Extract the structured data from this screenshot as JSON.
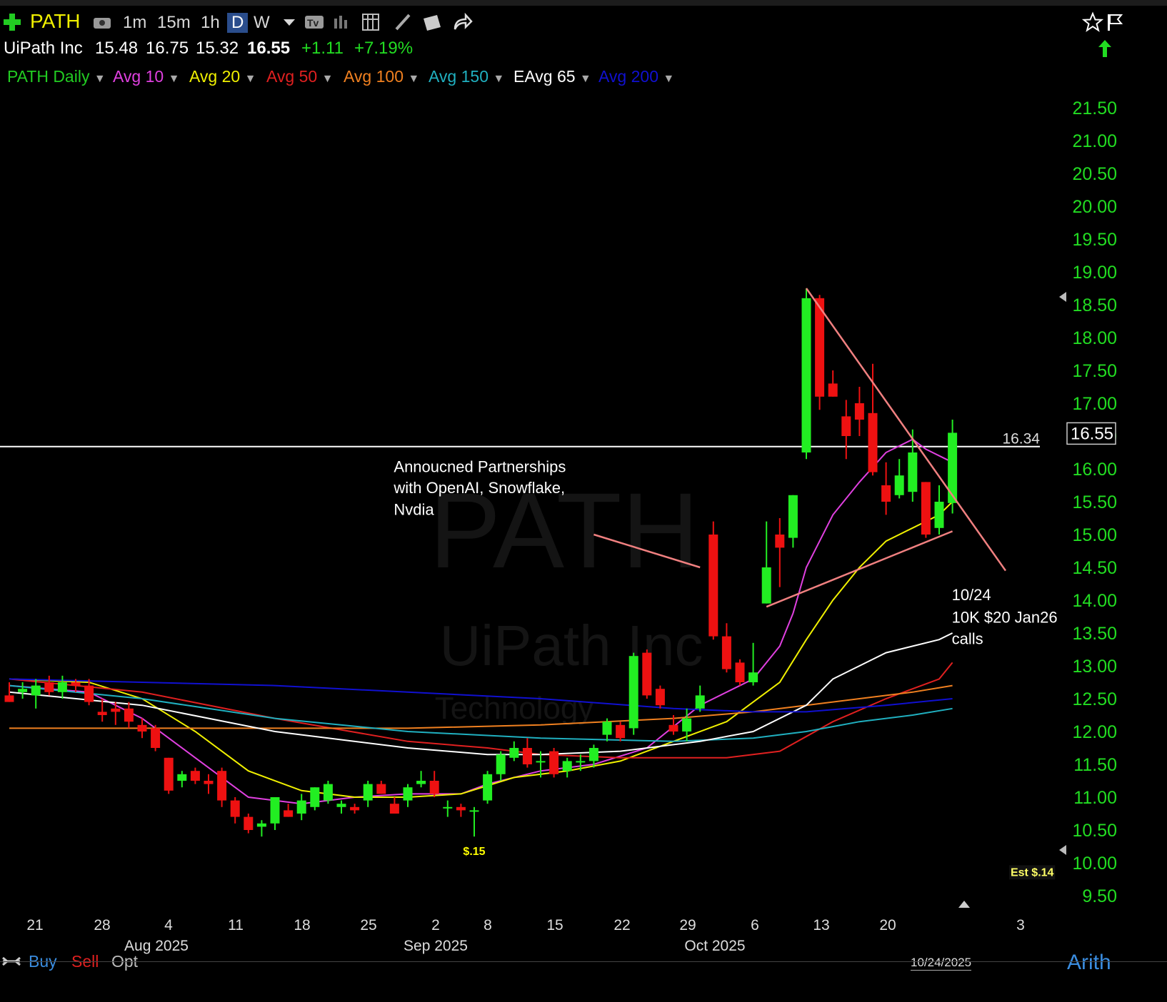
{
  "toolbar": {
    "symbol": "PATH",
    "intervals": [
      "1m",
      "15m",
      "1h",
      "D",
      "W"
    ],
    "active_interval": "D",
    "icons": [
      "add-icon",
      "camera-icon",
      "template-icon",
      "bars-icon",
      "grid-icon",
      "pencil-icon",
      "folder-icon",
      "share-icon",
      "star-icon"
    ]
  },
  "quote": {
    "name": "UiPath Inc",
    "open": "15.48",
    "high": "16.75",
    "low": "15.32",
    "last": "16.55",
    "change": "+1.11",
    "change_pct": "+7.19%"
  },
  "legend": [
    {
      "label": "PATH Daily",
      "color": "#22cc22"
    },
    {
      "label": "Avg 10",
      "color": "#e040e0"
    },
    {
      "label": "Avg 20",
      "color": "#f0f000"
    },
    {
      "label": "Avg 50",
      "color": "#e02020"
    },
    {
      "label": "Avg 100",
      "color": "#f08020"
    },
    {
      "label": "Avg 150",
      "color": "#20b0c0"
    },
    {
      "label": "EAvg 65",
      "color": "#ffffff"
    },
    {
      "label": "Avg 200",
      "color": "#1010d0"
    }
  ],
  "watermark": {
    "symbol": "PATH",
    "name": "UiPath Inc",
    "sector": "Technology"
  },
  "chart_data": {
    "type": "candlestick",
    "ylim": [
      9.3,
      21.8
    ],
    "y_ticks": [
      "21.50",
      "21.00",
      "20.50",
      "20.00",
      "19.50",
      "19.00",
      "18.50",
      "18.00",
      "17.50",
      "17.00",
      "16.50",
      "16.00",
      "15.50",
      "15.00",
      "14.50",
      "14.00",
      "13.50",
      "13.00",
      "12.50",
      "12.00",
      "11.50",
      "11.00",
      "10.50",
      "10.00",
      "9.50"
    ],
    "x_ticks": [
      "21",
      "28",
      "4",
      "11",
      "18",
      "25",
      "2",
      "8",
      "15",
      "22",
      "29",
      "6",
      "13",
      "20",
      "3"
    ],
    "month_labels": [
      "Aug 2025",
      "Sep 2025",
      "Oct 2025"
    ],
    "last_price_label": "16.55",
    "horizontal_line": {
      "value": 16.34,
      "label": "16.34"
    },
    "candles": [
      {
        "o": 12.55,
        "h": 12.75,
        "l": 12.45,
        "c": 12.45
      },
      {
        "o": 12.6,
        "h": 12.75,
        "l": 12.5,
        "c": 12.65
      },
      {
        "o": 12.55,
        "h": 12.8,
        "l": 12.35,
        "c": 12.7
      },
      {
        "o": 12.75,
        "h": 12.85,
        "l": 12.55,
        "c": 12.6
      },
      {
        "o": 12.6,
        "h": 12.85,
        "l": 12.5,
        "c": 12.75
      },
      {
        "o": 12.75,
        "h": 12.8,
        "l": 12.6,
        "c": 12.7
      },
      {
        "o": 12.7,
        "h": 12.8,
        "l": 12.4,
        "c": 12.45
      },
      {
        "o": 12.3,
        "h": 12.5,
        "l": 12.15,
        "c": 12.25
      },
      {
        "o": 12.35,
        "h": 12.45,
        "l": 12.1,
        "c": 12.3
      },
      {
        "o": 12.35,
        "h": 12.45,
        "l": 12.05,
        "c": 12.15
      },
      {
        "o": 12.1,
        "h": 12.2,
        "l": 11.9,
        "c": 12.0
      },
      {
        "o": 12.05,
        "h": 12.1,
        "l": 11.7,
        "c": 11.75
      },
      {
        "o": 11.6,
        "h": 11.6,
        "l": 11.05,
        "c": 11.1
      },
      {
        "o": 11.25,
        "h": 11.4,
        "l": 11.15,
        "c": 11.35
      },
      {
        "o": 11.4,
        "h": 11.45,
        "l": 11.2,
        "c": 11.25
      },
      {
        "o": 11.25,
        "h": 11.35,
        "l": 11.05,
        "c": 11.2
      },
      {
        "o": 11.4,
        "h": 11.45,
        "l": 10.85,
        "c": 10.95
      },
      {
        "o": 10.95,
        "h": 11.0,
        "l": 10.6,
        "c": 10.7
      },
      {
        "o": 10.7,
        "h": 10.75,
        "l": 10.45,
        "c": 10.5
      },
      {
        "o": 10.55,
        "h": 10.65,
        "l": 10.4,
        "c": 10.6
      },
      {
        "o": 10.6,
        "h": 11.0,
        "l": 10.5,
        "c": 11.0
      },
      {
        "o": 10.8,
        "h": 10.9,
        "l": 10.7,
        "c": 10.7
      },
      {
        "o": 10.75,
        "h": 11.05,
        "l": 10.65,
        "c": 10.95
      },
      {
        "o": 10.85,
        "h": 11.15,
        "l": 10.8,
        "c": 11.15
      },
      {
        "o": 10.95,
        "h": 11.25,
        "l": 10.9,
        "c": 11.2
      },
      {
        "o": 10.85,
        "h": 10.95,
        "l": 10.75,
        "c": 10.9
      },
      {
        "o": 10.85,
        "h": 10.9,
        "l": 10.75,
        "c": 10.8
      },
      {
        "o": 10.95,
        "h": 11.25,
        "l": 10.85,
        "c": 11.2
      },
      {
        "o": 11.2,
        "h": 11.25,
        "l": 11.05,
        "c": 11.05
      },
      {
        "o": 10.9,
        "h": 11.0,
        "l": 10.75,
        "c": 10.75
      },
      {
        "o": 10.95,
        "h": 11.2,
        "l": 10.85,
        "c": 11.15
      },
      {
        "o": 11.2,
        "h": 11.4,
        "l": 11.15,
        "c": 11.25
      },
      {
        "o": 11.25,
        "h": 11.4,
        "l": 11.0,
        "c": 11.05
      },
      {
        "o": 10.85,
        "h": 10.95,
        "l": 10.7,
        "c": 10.85
      },
      {
        "o": 10.85,
        "h": 10.9,
        "l": 10.7,
        "c": 10.8
      },
      {
        "o": 10.8,
        "h": 10.85,
        "l": 10.4,
        "c": 10.8
      },
      {
        "o": 10.95,
        "h": 11.4,
        "l": 10.9,
        "c": 11.35
      },
      {
        "o": 11.35,
        "h": 11.7,
        "l": 11.25,
        "c": 11.65
      },
      {
        "o": 11.6,
        "h": 11.85,
        "l": 11.55,
        "c": 11.75
      },
      {
        "o": 11.75,
        "h": 11.9,
        "l": 11.45,
        "c": 11.5
      },
      {
        "o": 11.55,
        "h": 11.7,
        "l": 11.3,
        "c": 11.55
      },
      {
        "o": 11.7,
        "h": 11.75,
        "l": 11.3,
        "c": 11.35
      },
      {
        "o": 11.4,
        "h": 11.6,
        "l": 11.3,
        "c": 11.55
      },
      {
        "o": 11.55,
        "h": 11.65,
        "l": 11.4,
        "c": 11.55
      },
      {
        "o": 11.55,
        "h": 11.8,
        "l": 11.45,
        "c": 11.75
      },
      {
        "o": 11.95,
        "h": 12.2,
        "l": 11.85,
        "c": 12.15
      },
      {
        "o": 12.1,
        "h": 12.15,
        "l": 11.85,
        "c": 11.9
      },
      {
        "o": 12.05,
        "h": 13.2,
        "l": 11.95,
        "c": 13.15
      },
      {
        "o": 13.2,
        "h": 13.25,
        "l": 12.5,
        "c": 12.55
      },
      {
        "o": 12.65,
        "h": 12.7,
        "l": 12.35,
        "c": 12.4
      },
      {
        "o": 12.1,
        "h": 12.25,
        "l": 11.95,
        "c": 12.0
      },
      {
        "o": 12.0,
        "h": 12.35,
        "l": 11.85,
        "c": 12.2
      },
      {
        "o": 12.35,
        "h": 12.7,
        "l": 12.3,
        "c": 12.55
      },
      {
        "o": 15.0,
        "h": 15.2,
        "l": 13.4,
        "c": 13.45
      },
      {
        "o": 13.45,
        "h": 13.65,
        "l": 12.9,
        "c": 12.95
      },
      {
        "o": 13.05,
        "h": 13.1,
        "l": 12.7,
        "c": 12.75
      },
      {
        "o": 12.75,
        "h": 13.35,
        "l": 12.7,
        "c": 12.9
      },
      {
        "o": 13.95,
        "h": 15.2,
        "l": 13.95,
        "c": 14.5
      },
      {
        "o": 15.0,
        "h": 15.25,
        "l": 14.2,
        "c": 14.8
      },
      {
        "o": 14.95,
        "h": 15.6,
        "l": 14.8,
        "c": 15.6
      },
      {
        "o": 16.25,
        "h": 18.75,
        "l": 16.15,
        "c": 18.6
      },
      {
        "o": 18.6,
        "h": 18.65,
        "l": 16.9,
        "c": 17.1
      },
      {
        "o": 17.3,
        "h": 17.5,
        "l": 17.1,
        "c": 17.1
      },
      {
        "o": 16.8,
        "h": 17.05,
        "l": 16.15,
        "c": 16.5
      },
      {
        "o": 17.0,
        "h": 17.25,
        "l": 16.5,
        "c": 16.75
      },
      {
        "o": 16.85,
        "h": 17.6,
        "l": 15.9,
        "c": 15.95
      },
      {
        "o": 15.75,
        "h": 16.1,
        "l": 15.3,
        "c": 15.5
      },
      {
        "o": 15.6,
        "h": 16.15,
        "l": 15.55,
        "c": 15.9
      },
      {
        "o": 15.65,
        "h": 16.6,
        "l": 15.5,
        "c": 16.25
      },
      {
        "o": 15.8,
        "h": 15.8,
        "l": 14.95,
        "c": 15.0
      },
      {
        "o": 15.1,
        "h": 15.75,
        "l": 15.0,
        "c": 15.5
      },
      {
        "o": 15.48,
        "h": 16.75,
        "l": 15.32,
        "c": 16.55
      }
    ],
    "moving_averages": [
      {
        "name": "Avg 10",
        "color": "#e040e0",
        "points": [
          [
            0,
            12.7
          ],
          [
            6,
            12.6
          ],
          [
            10,
            12.2
          ],
          [
            14,
            11.6
          ],
          [
            18,
            11.0
          ],
          [
            22,
            10.9
          ],
          [
            26,
            11.0
          ],
          [
            30,
            11.05
          ],
          [
            34,
            11.05
          ],
          [
            36,
            11.2
          ],
          [
            40,
            11.4
          ],
          [
            44,
            11.5
          ],
          [
            48,
            11.75
          ],
          [
            52,
            12.4
          ],
          [
            56,
            12.8
          ],
          [
            58,
            13.3
          ],
          [
            59,
            13.8
          ],
          [
            60,
            14.5
          ],
          [
            62,
            15.3
          ],
          [
            64,
            15.8
          ],
          [
            66,
            16.25
          ],
          [
            68,
            16.45
          ],
          [
            69,
            16.3
          ],
          [
            71,
            16.1
          ]
        ]
      },
      {
        "name": "Avg 20",
        "color": "#f0f000",
        "points": [
          [
            0,
            12.8
          ],
          [
            6,
            12.75
          ],
          [
            10,
            12.5
          ],
          [
            14,
            12.0
          ],
          [
            18,
            11.4
          ],
          [
            22,
            11.1
          ],
          [
            26,
            11.0
          ],
          [
            30,
            11.0
          ],
          [
            34,
            11.05
          ],
          [
            38,
            11.3
          ],
          [
            42,
            11.4
          ],
          [
            46,
            11.55
          ],
          [
            50,
            11.85
          ],
          [
            54,
            12.15
          ],
          [
            58,
            12.75
          ],
          [
            60,
            13.4
          ],
          [
            62,
            14.0
          ],
          [
            64,
            14.5
          ],
          [
            66,
            14.9
          ],
          [
            68,
            15.1
          ],
          [
            70,
            15.3
          ],
          [
            71,
            15.5
          ]
        ]
      },
      {
        "name": "Avg 50",
        "color": "#e02020",
        "points": [
          [
            0,
            12.8
          ],
          [
            10,
            12.6
          ],
          [
            20,
            12.2
          ],
          [
            30,
            11.85
          ],
          [
            36,
            11.75
          ],
          [
            40,
            11.65
          ],
          [
            46,
            11.6
          ],
          [
            54,
            11.6
          ],
          [
            58,
            11.7
          ],
          [
            62,
            12.15
          ],
          [
            66,
            12.5
          ],
          [
            70,
            12.8
          ],
          [
            71,
            13.05
          ]
        ]
      },
      {
        "name": "Avg 100",
        "color": "#f08020",
        "points": [
          [
            0,
            12.05
          ],
          [
            10,
            12.05
          ],
          [
            20,
            12.05
          ],
          [
            30,
            12.05
          ],
          [
            40,
            12.1
          ],
          [
            50,
            12.2
          ],
          [
            56,
            12.3
          ],
          [
            60,
            12.4
          ],
          [
            64,
            12.5
          ],
          [
            68,
            12.6
          ],
          [
            71,
            12.7
          ]
        ]
      },
      {
        "name": "Avg 150",
        "color": "#20b0c0",
        "points": [
          [
            0,
            12.7
          ],
          [
            10,
            12.5
          ],
          [
            20,
            12.2
          ],
          [
            30,
            12.0
          ],
          [
            40,
            11.9
          ],
          [
            50,
            11.85
          ],
          [
            56,
            11.9
          ],
          [
            60,
            12.0
          ],
          [
            64,
            12.15
          ],
          [
            68,
            12.25
          ],
          [
            71,
            12.35
          ]
        ]
      },
      {
        "name": "EAvg 65",
        "color": "#ffffff",
        "points": [
          [
            0,
            12.6
          ],
          [
            10,
            12.4
          ],
          [
            20,
            12.0
          ],
          [
            30,
            11.75
          ],
          [
            36,
            11.65
          ],
          [
            40,
            11.65
          ],
          [
            46,
            11.7
          ],
          [
            52,
            11.85
          ],
          [
            56,
            12.0
          ],
          [
            60,
            12.4
          ],
          [
            62,
            12.8
          ],
          [
            66,
            13.2
          ],
          [
            70,
            13.4
          ],
          [
            71,
            13.5
          ]
        ]
      },
      {
        "name": "Avg 200",
        "color": "#1010d0",
        "points": [
          [
            0,
            12.8
          ],
          [
            10,
            12.75
          ],
          [
            20,
            12.7
          ],
          [
            30,
            12.6
          ],
          [
            40,
            12.5
          ],
          [
            50,
            12.35
          ],
          [
            56,
            12.3
          ],
          [
            60,
            12.3
          ],
          [
            66,
            12.4
          ],
          [
            71,
            12.5
          ]
        ]
      }
    ],
    "trendlines": [
      {
        "from": [
          60,
          18.75
        ],
        "to": [
          75,
          14.45
        ]
      },
      {
        "from": [
          57,
          13.9
        ],
        "to": [
          71,
          15.05
        ]
      },
      {
        "from": [
          44,
          15.0
        ],
        "to": [
          52,
          14.5
        ]
      }
    ],
    "annotations": [
      {
        "text": "Annoucned Partnerships",
        "at": [
          29,
          15.95
        ]
      },
      {
        "text": " with OpenAI, Snowflake,",
        "at": [
          29,
          15.63
        ]
      },
      {
        "text": "Nvdia",
        "at": [
          29,
          15.3
        ]
      },
      {
        "text": "10/24",
        "at": [
          71,
          14.0
        ]
      },
      {
        "text": "10K $20 Jan26",
        "at": [
          71,
          13.66
        ]
      },
      {
        "text": "calls",
        "at": [
          71,
          13.33
        ]
      }
    ],
    "earnings_labels": [
      {
        "text": "$.15",
        "at": [
          35,
          10.12
        ]
      },
      {
        "text": "Est $.14",
        "at": [
          77,
          9.8
        ]
      }
    ]
  },
  "bottom": {
    "buy": "Buy",
    "sell": "Sell",
    "opt": "Opt",
    "date_box": "10/24/2025",
    "scale": "Arith"
  }
}
